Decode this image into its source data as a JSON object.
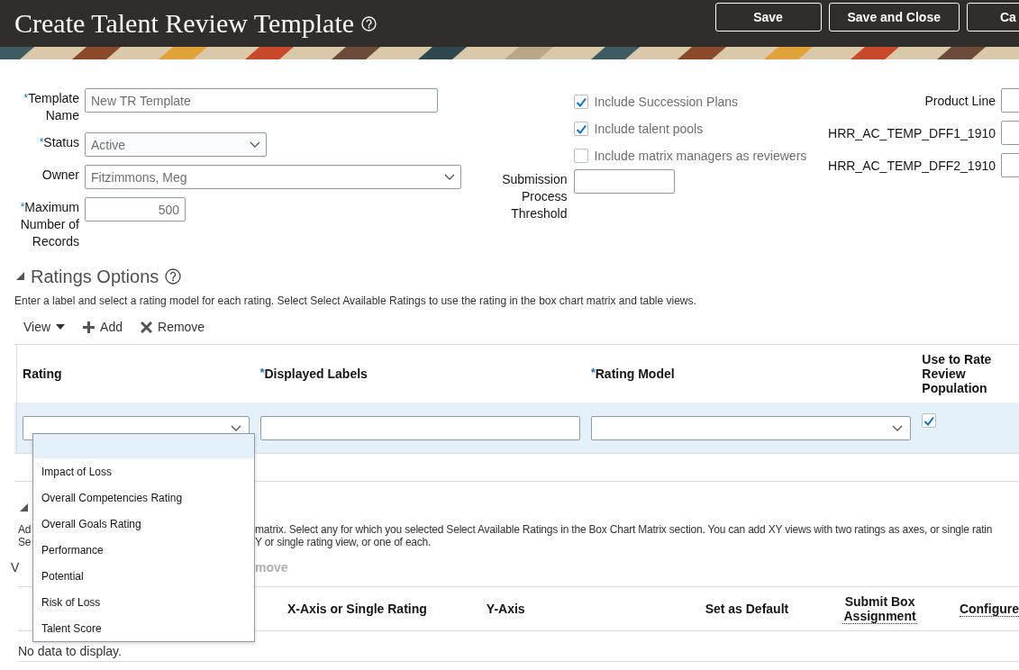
{
  "header": {
    "title": "Create Talent Review Template",
    "buttons": [
      {
        "label": "Save"
      },
      {
        "label": "Save and Close"
      },
      {
        "label": "Ca"
      }
    ]
  },
  "form": {
    "left_fields": [
      {
        "label": "Template Name",
        "required_mark": "*",
        "kind": "text",
        "value": "New TR Template"
      },
      {
        "label": "Status",
        "required_mark": "*",
        "kind": "select",
        "value": "Active"
      },
      {
        "label": "Owner",
        "kind": "combo",
        "value": "Fitzimmons, Meg"
      },
      {
        "label": "Maximum Number of Records",
        "required_mark": "*",
        "kind": "number",
        "value": "500"
      }
    ],
    "checkboxes": [
      {
        "label": "Include Succession Plans",
        "checked": true
      },
      {
        "label": "Include talent pools",
        "checked": true
      },
      {
        "label": "Include matrix managers as reviewers",
        "checked": false
      }
    ],
    "threshold": {
      "label": "Submission Process Threshold"
    },
    "right_fields": [
      {
        "label": "Product Line"
      },
      {
        "label": "HRR_AC_TEMP_DFF1_1910"
      },
      {
        "label": "HRR_AC_TEMP_DFF2_1910"
      }
    ]
  },
  "ratings": {
    "title": "Ratings Options",
    "expanded": true,
    "description": "Enter a label and select a rating model for each rating. Select Select Available Ratings to use the rating in the box chart matrix and table views.",
    "toolbar": [
      {
        "label": "View",
        "kind": "menu"
      },
      {
        "label": "Add",
        "kind": "add"
      },
      {
        "label": "Remove",
        "kind": "remove"
      }
    ],
    "columns": [
      {
        "label": "Rating"
      },
      {
        "label": "Displayed Labels",
        "required_mark": "*"
      },
      {
        "label": "Rating Model",
        "required_mark": "*"
      },
      {
        "label": "Use to Rate Review Population"
      }
    ],
    "rows": [
      {
        "selected": true,
        "use_to_rate": true
      }
    ],
    "dropdown": {
      "blank_highlighted": true,
      "options": [
        {
          "label": "Impact of Loss"
        },
        {
          "label": "Overall Competencies Rating"
        },
        {
          "label": "Overall Goals Rating"
        },
        {
          "label": "Performance"
        },
        {
          "label": "Potential"
        },
        {
          "label": "Risk of Loss"
        },
        {
          "label": "Talent Score"
        }
      ]
    }
  },
  "views": {
    "expanded": true,
    "description_lines": [
      [
        "Ad",
        "matrix. Select any for which you selected Select Available Ratings in the Box Chart Matrix section. You can add XY views with two ratings as axes, or single ratin"
      ],
      [
        "Se",
        "Y or single rating view, or one of each."
      ]
    ],
    "toolbar_fragments": [
      "V",
      "move"
    ],
    "columns": [
      {
        "label": "X-Axis or Single Rating"
      },
      {
        "label": "Y-Axis"
      },
      {
        "label": "Set as Default"
      },
      {
        "label": "Submit Box Assignment",
        "dotted": true
      },
      {
        "label": "Configure",
        "dotted": true
      }
    ],
    "empty_message": "No data to display."
  }
}
